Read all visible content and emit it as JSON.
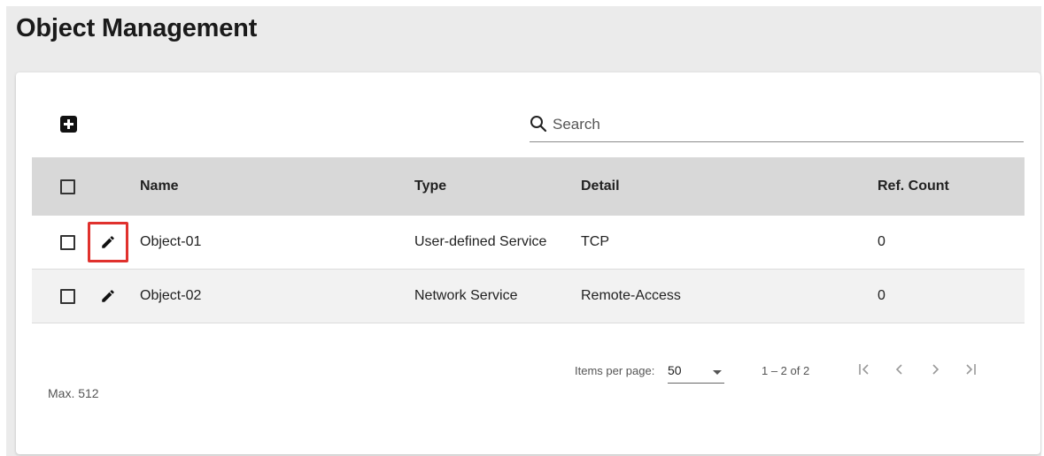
{
  "page": {
    "title": "Object Management"
  },
  "toolbar": {
    "search_placeholder": "Search"
  },
  "table": {
    "headers": {
      "name": "Name",
      "type": "Type",
      "detail": "Detail",
      "ref_count": "Ref. Count"
    },
    "rows": [
      {
        "name": "Object-01",
        "type": "User-defined Service",
        "detail": "TCP",
        "ref_count": "0",
        "highlighted_edit": true
      },
      {
        "name": "Object-02",
        "type": "Network Service",
        "detail": "Remote-Access",
        "ref_count": "0",
        "highlighted_edit": false
      }
    ]
  },
  "footer": {
    "max_label": "Max. 512",
    "items_per_page_label": "Items per page:",
    "items_per_page_value": "50",
    "range_label": "1 – 2 of 2"
  },
  "colors": {
    "header_bg": "#d8d8d8",
    "highlight": "#e0312d",
    "page_bg": "#ebebeb"
  },
  "icons": [
    "add-icon",
    "search-icon",
    "edit-icon",
    "first-page-icon",
    "prev-page-icon",
    "next-page-icon",
    "last-page-icon"
  ]
}
